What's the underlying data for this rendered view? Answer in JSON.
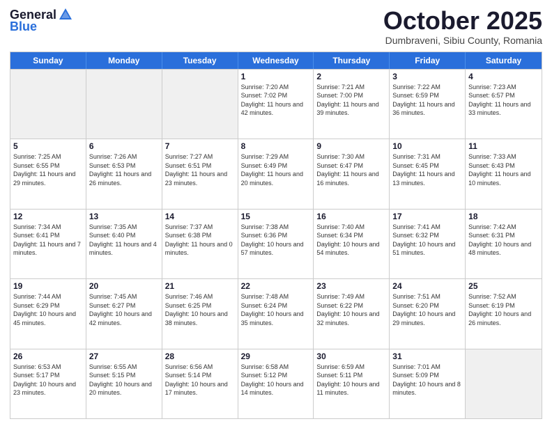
{
  "header": {
    "logo_general": "General",
    "logo_blue": "Blue",
    "month_title": "October 2025",
    "subtitle": "Dumbraveni, Sibiu County, Romania"
  },
  "days_of_week": [
    "Sunday",
    "Monday",
    "Tuesday",
    "Wednesday",
    "Thursday",
    "Friday",
    "Saturday"
  ],
  "weeks": [
    [
      {
        "day": "",
        "sunrise": "",
        "sunset": "",
        "daylight": "",
        "empty": true
      },
      {
        "day": "",
        "sunrise": "",
        "sunset": "",
        "daylight": "",
        "empty": true
      },
      {
        "day": "",
        "sunrise": "",
        "sunset": "",
        "daylight": "",
        "empty": true
      },
      {
        "day": "1",
        "sunrise": "Sunrise: 7:20 AM",
        "sunset": "Sunset: 7:02 PM",
        "daylight": "Daylight: 11 hours and 42 minutes."
      },
      {
        "day": "2",
        "sunrise": "Sunrise: 7:21 AM",
        "sunset": "Sunset: 7:00 PM",
        "daylight": "Daylight: 11 hours and 39 minutes."
      },
      {
        "day": "3",
        "sunrise": "Sunrise: 7:22 AM",
        "sunset": "Sunset: 6:59 PM",
        "daylight": "Daylight: 11 hours and 36 minutes."
      },
      {
        "day": "4",
        "sunrise": "Sunrise: 7:23 AM",
        "sunset": "Sunset: 6:57 PM",
        "daylight": "Daylight: 11 hours and 33 minutes."
      }
    ],
    [
      {
        "day": "5",
        "sunrise": "Sunrise: 7:25 AM",
        "sunset": "Sunset: 6:55 PM",
        "daylight": "Daylight: 11 hours and 29 minutes."
      },
      {
        "day": "6",
        "sunrise": "Sunrise: 7:26 AM",
        "sunset": "Sunset: 6:53 PM",
        "daylight": "Daylight: 11 hours and 26 minutes."
      },
      {
        "day": "7",
        "sunrise": "Sunrise: 7:27 AM",
        "sunset": "Sunset: 6:51 PM",
        "daylight": "Daylight: 11 hours and 23 minutes."
      },
      {
        "day": "8",
        "sunrise": "Sunrise: 7:29 AM",
        "sunset": "Sunset: 6:49 PM",
        "daylight": "Daylight: 11 hours and 20 minutes."
      },
      {
        "day": "9",
        "sunrise": "Sunrise: 7:30 AM",
        "sunset": "Sunset: 6:47 PM",
        "daylight": "Daylight: 11 hours and 16 minutes."
      },
      {
        "day": "10",
        "sunrise": "Sunrise: 7:31 AM",
        "sunset": "Sunset: 6:45 PM",
        "daylight": "Daylight: 11 hours and 13 minutes."
      },
      {
        "day": "11",
        "sunrise": "Sunrise: 7:33 AM",
        "sunset": "Sunset: 6:43 PM",
        "daylight": "Daylight: 11 hours and 10 minutes."
      }
    ],
    [
      {
        "day": "12",
        "sunrise": "Sunrise: 7:34 AM",
        "sunset": "Sunset: 6:41 PM",
        "daylight": "Daylight: 11 hours and 7 minutes."
      },
      {
        "day": "13",
        "sunrise": "Sunrise: 7:35 AM",
        "sunset": "Sunset: 6:40 PM",
        "daylight": "Daylight: 11 hours and 4 minutes."
      },
      {
        "day": "14",
        "sunrise": "Sunrise: 7:37 AM",
        "sunset": "Sunset: 6:38 PM",
        "daylight": "Daylight: 11 hours and 0 minutes."
      },
      {
        "day": "15",
        "sunrise": "Sunrise: 7:38 AM",
        "sunset": "Sunset: 6:36 PM",
        "daylight": "Daylight: 10 hours and 57 minutes."
      },
      {
        "day": "16",
        "sunrise": "Sunrise: 7:40 AM",
        "sunset": "Sunset: 6:34 PM",
        "daylight": "Daylight: 10 hours and 54 minutes."
      },
      {
        "day": "17",
        "sunrise": "Sunrise: 7:41 AM",
        "sunset": "Sunset: 6:32 PM",
        "daylight": "Daylight: 10 hours and 51 minutes."
      },
      {
        "day": "18",
        "sunrise": "Sunrise: 7:42 AM",
        "sunset": "Sunset: 6:31 PM",
        "daylight": "Daylight: 10 hours and 48 minutes."
      }
    ],
    [
      {
        "day": "19",
        "sunrise": "Sunrise: 7:44 AM",
        "sunset": "Sunset: 6:29 PM",
        "daylight": "Daylight: 10 hours and 45 minutes."
      },
      {
        "day": "20",
        "sunrise": "Sunrise: 7:45 AM",
        "sunset": "Sunset: 6:27 PM",
        "daylight": "Daylight: 10 hours and 42 minutes."
      },
      {
        "day": "21",
        "sunrise": "Sunrise: 7:46 AM",
        "sunset": "Sunset: 6:25 PM",
        "daylight": "Daylight: 10 hours and 38 minutes."
      },
      {
        "day": "22",
        "sunrise": "Sunrise: 7:48 AM",
        "sunset": "Sunset: 6:24 PM",
        "daylight": "Daylight: 10 hours and 35 minutes."
      },
      {
        "day": "23",
        "sunrise": "Sunrise: 7:49 AM",
        "sunset": "Sunset: 6:22 PM",
        "daylight": "Daylight: 10 hours and 32 minutes."
      },
      {
        "day": "24",
        "sunrise": "Sunrise: 7:51 AM",
        "sunset": "Sunset: 6:20 PM",
        "daylight": "Daylight: 10 hours and 29 minutes."
      },
      {
        "day": "25",
        "sunrise": "Sunrise: 7:52 AM",
        "sunset": "Sunset: 6:19 PM",
        "daylight": "Daylight: 10 hours and 26 minutes."
      }
    ],
    [
      {
        "day": "26",
        "sunrise": "Sunrise: 6:53 AM",
        "sunset": "Sunset: 5:17 PM",
        "daylight": "Daylight: 10 hours and 23 minutes."
      },
      {
        "day": "27",
        "sunrise": "Sunrise: 6:55 AM",
        "sunset": "Sunset: 5:15 PM",
        "daylight": "Daylight: 10 hours and 20 minutes."
      },
      {
        "day": "28",
        "sunrise": "Sunrise: 6:56 AM",
        "sunset": "Sunset: 5:14 PM",
        "daylight": "Daylight: 10 hours and 17 minutes."
      },
      {
        "day": "29",
        "sunrise": "Sunrise: 6:58 AM",
        "sunset": "Sunset: 5:12 PM",
        "daylight": "Daylight: 10 hours and 14 minutes."
      },
      {
        "day": "30",
        "sunrise": "Sunrise: 6:59 AM",
        "sunset": "Sunset: 5:11 PM",
        "daylight": "Daylight: 10 hours and 11 minutes."
      },
      {
        "day": "31",
        "sunrise": "Sunrise: 7:01 AM",
        "sunset": "Sunset: 5:09 PM",
        "daylight": "Daylight: 10 hours and 8 minutes."
      },
      {
        "day": "",
        "sunrise": "",
        "sunset": "",
        "daylight": "",
        "empty": true
      }
    ]
  ]
}
